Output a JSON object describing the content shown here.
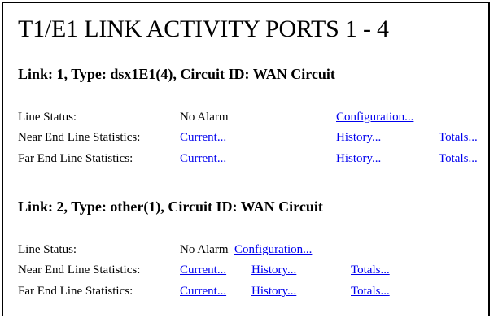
{
  "page": {
    "title": "T1/E1 LINK ACTIVITY PORTS 1 - 4"
  },
  "links": [
    {
      "heading": "Link: 1, Type: dsx1E1(4), Circuit ID: WAN Circuit",
      "line_status": {
        "label": "Line Status:",
        "value": "No Alarm",
        "config_link": "Configuration..."
      },
      "near_end": {
        "label": "Near End Line Statistics:",
        "current": "Current...",
        "history": "History...",
        "totals": "Totals..."
      },
      "far_end": {
        "label": "Far End Line Statistics:",
        "current": "Current...",
        "history": "History...",
        "totals": "Totals..."
      }
    },
    {
      "heading": "Link: 2, Type: other(1), Circuit ID: WAN Circuit",
      "line_status": {
        "label": "Line Status:",
        "value": "No Alarm",
        "config_link": "Configuration..."
      },
      "near_end": {
        "label": "Near End Line Statistics:",
        "current": "Current...",
        "history": "History...",
        "totals": "Totals..."
      },
      "far_end": {
        "label": "Far End Line Statistics:",
        "current": "Current...",
        "history": "History...",
        "totals": "Totals..."
      }
    }
  ],
  "colors": {
    "link": "#0000ee",
    "text": "#000000",
    "background": "#ffffff",
    "border": "#000000"
  }
}
